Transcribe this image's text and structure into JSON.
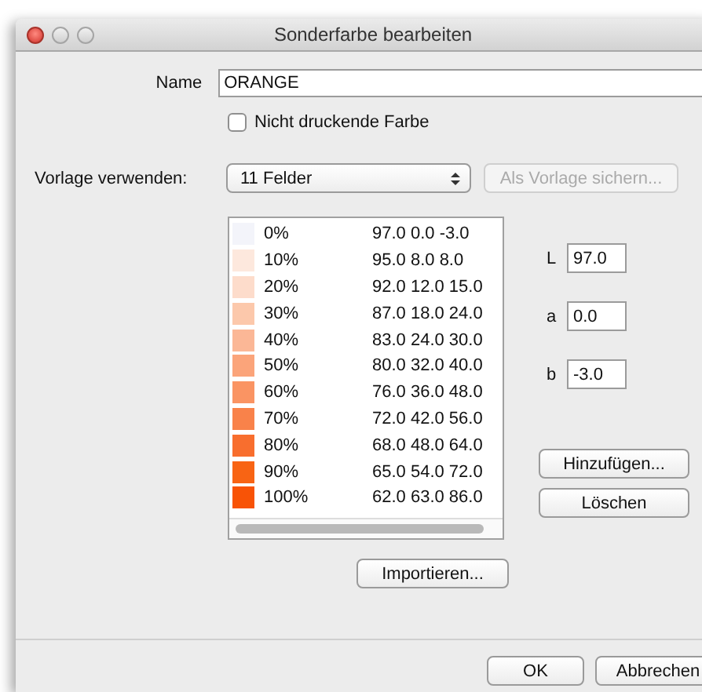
{
  "window": {
    "title": "Sonderfarbe bearbeiten"
  },
  "name_field": {
    "label": "Name",
    "value": "ORANGE"
  },
  "nonprinting": {
    "label": "Nicht druckende Farbe",
    "checked": false
  },
  "template": {
    "label": "Vorlage verwenden:",
    "value": "11 Felder",
    "save_button": {
      "label": "Als Vorlage sichern...",
      "disabled": true
    }
  },
  "tints": [
    {
      "percent": "0%",
      "values": "97.0 0.0 -3.0",
      "color": "#f3f4fa"
    },
    {
      "percent": "10%",
      "values": "95.0 8.0 8.0",
      "color": "#fde8dd"
    },
    {
      "percent": "20%",
      "values": "92.0 12.0 15.0",
      "color": "#fddccb"
    },
    {
      "percent": "30%",
      "values": "87.0 18.0 24.0",
      "color": "#fcc8ab"
    },
    {
      "percent": "40%",
      "values": "83.0 24.0 30.0",
      "color": "#fbb796"
    },
    {
      "percent": "50%",
      "values": "80.0 32.0 40.0",
      "color": "#fba47a"
    },
    {
      "percent": "60%",
      "values": "76.0 36.0 48.0",
      "color": "#fa9463"
    },
    {
      "percent": "70%",
      "values": "72.0 42.0 56.0",
      "color": "#f9824a"
    },
    {
      "percent": "80%",
      "values": "68.0 48.0 64.0",
      "color": "#f86e2e"
    },
    {
      "percent": "90%",
      "values": "65.0 54.0 72.0",
      "color": "#f86414"
    },
    {
      "percent": "100%",
      "values": "62.0 63.0 86.0",
      "color": "#f85306"
    }
  ],
  "lab": [
    {
      "label": "L",
      "value": "97.0"
    },
    {
      "label": "a",
      "value": "0.0"
    },
    {
      "label": "b",
      "value": "-3.0"
    }
  ],
  "side_buttons": [
    "Hinzufügen...",
    "Löschen"
  ],
  "import_button": "Importieren...",
  "footer_buttons": [
    "OK",
    "Abbrechen"
  ]
}
